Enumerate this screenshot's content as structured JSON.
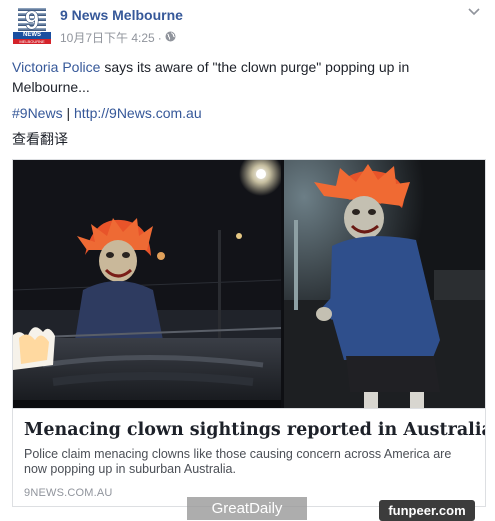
{
  "post": {
    "author": "9 News Melbourne",
    "timestamp": "10月7日下午 4:25",
    "separator": "·",
    "privacy_icon": "globe-icon",
    "text_link": "Victoria Police",
    "text_rest": " says its aware of \"the clown purge\" popping up in Melbourne...",
    "hashtag": "#9News",
    "link_separator": " | ",
    "url": "http://9News.com.au",
    "translate": "查看翻译"
  },
  "logo": {
    "numeral": "9",
    "band_text": "NEWS",
    "band_sub": "MELBOURNE"
  },
  "card": {
    "title": "Menacing clown sightings reported in Australia",
    "description": "Police claim menacing clowns like those causing concern across America are now popping up in suburban Australia.",
    "domain": "9NEWS.COM.AU"
  },
  "watermarks": {
    "left": "GreatDaily",
    "right": "funpeer.com"
  },
  "colors": {
    "link": "#365899",
    "text": "#1d2129",
    "meta": "#90949c",
    "clown_hair": "#e8542a"
  }
}
